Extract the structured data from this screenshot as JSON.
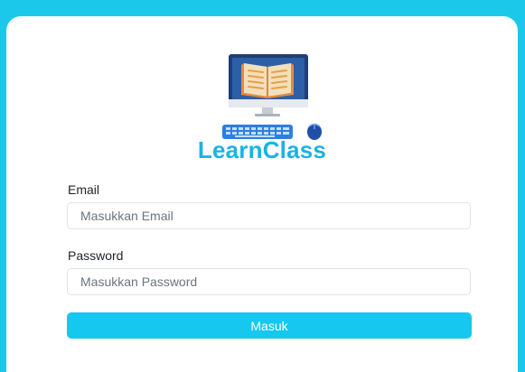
{
  "app": {
    "title": "LearnClass",
    "logo_icon": "computer-book-icon"
  },
  "form": {
    "email": {
      "label": "Email",
      "placeholder": "Masukkan Email",
      "value": ""
    },
    "password": {
      "label": "Password",
      "placeholder": "Masukkan Password",
      "value": ""
    },
    "submit_label": "Masuk"
  },
  "colors": {
    "background": "#1cc8ea",
    "card": "#ffffff",
    "title": "#1ab3e3",
    "button": "#16c8ef"
  }
}
